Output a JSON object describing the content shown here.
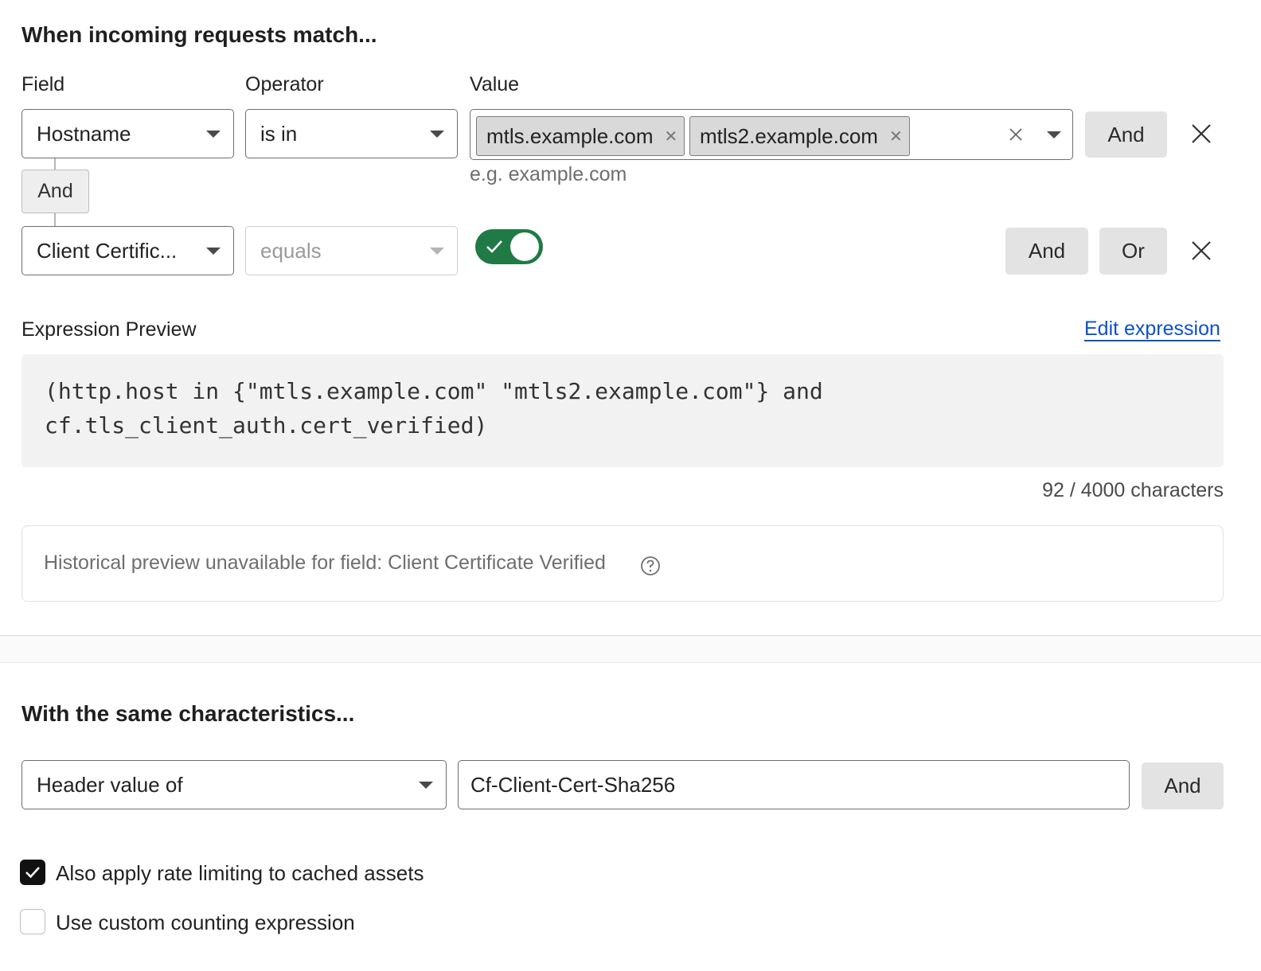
{
  "match_section": {
    "title": "When incoming requests match...",
    "labels": {
      "field": "Field",
      "operator": "Operator",
      "value": "Value"
    },
    "row1": {
      "field": "Hostname",
      "operator": "is in",
      "chips": [
        "mtls.example.com",
        "mtls2.example.com"
      ],
      "value_hint": "e.g. example.com",
      "and_label": "And"
    },
    "connector_label": "And",
    "row2": {
      "field": "Client Certific...",
      "operator": "equals",
      "toggle_on": true,
      "and_label": "And",
      "or_label": "Or"
    }
  },
  "expression": {
    "title": "Expression Preview",
    "edit_link": "Edit expression",
    "line1": "(http.host in {\"mtls.example.com\" \"mtls2.example.com\"} and",
    "line2": "cf.tls_client_auth.cert_verified)",
    "char_count": "92 / 4000 characters"
  },
  "historical_notice": "Historical preview unavailable for field: Client Certificate Verified",
  "characteristics": {
    "title": "With the same characteristics...",
    "select": "Header value of",
    "header_value": "Cf-Client-Cert-Sha256",
    "and_label": "And"
  },
  "options": {
    "cached_assets": {
      "label": "Also apply rate limiting to cached assets",
      "checked": true
    },
    "custom_counting": {
      "label": "Use custom counting expression",
      "checked": false
    }
  },
  "colors": {
    "toggle_green": "#1f7a45",
    "link_blue": "#0d51c9"
  }
}
